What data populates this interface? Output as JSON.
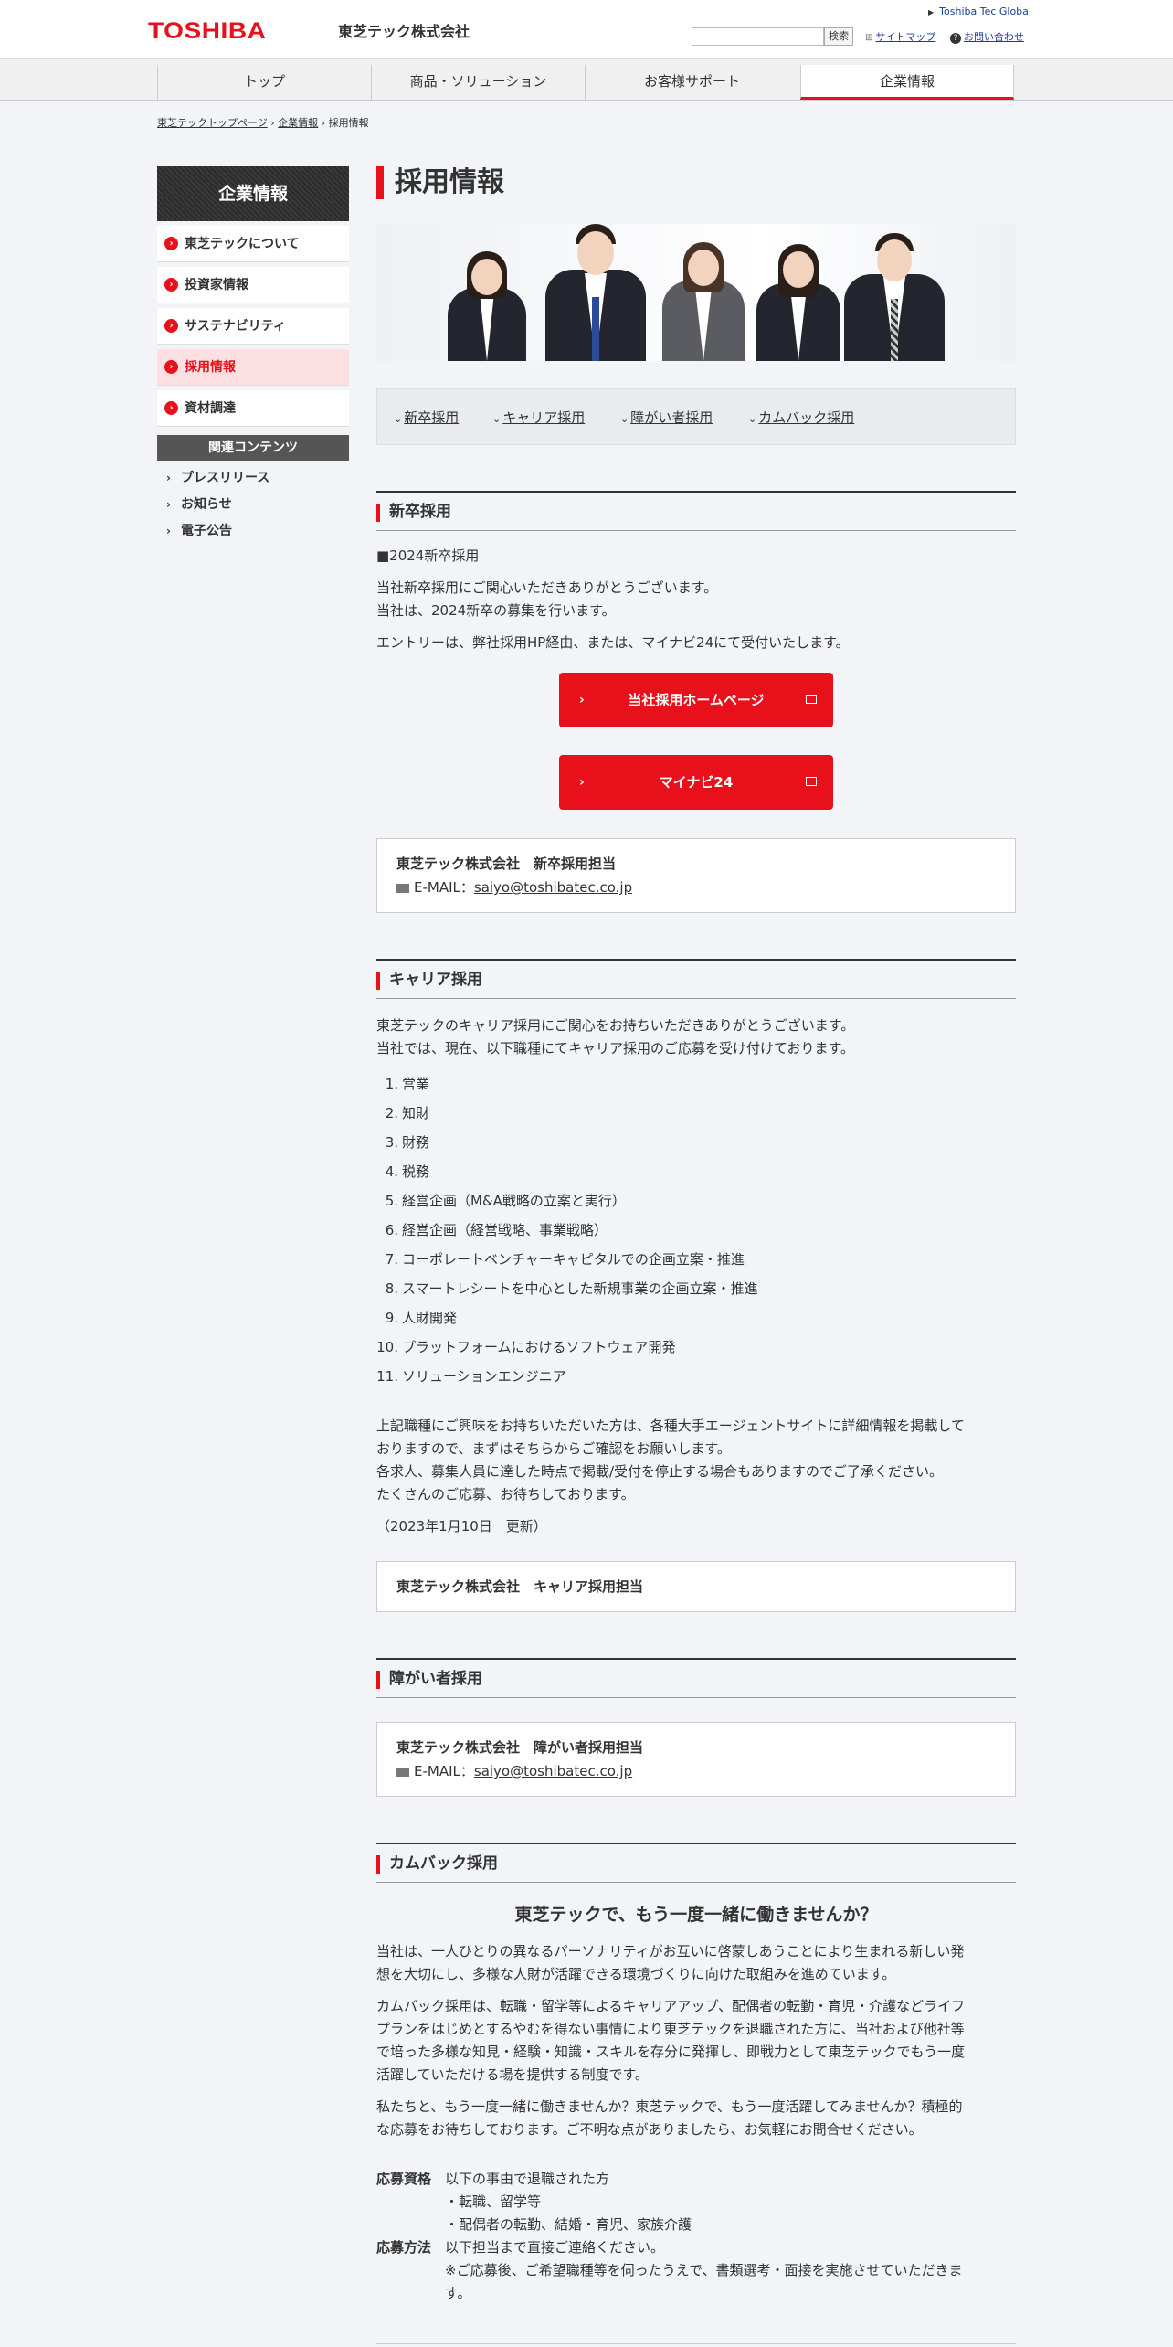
{
  "header": {
    "logo": "TOSHIBA",
    "company": "東芝テック株式会社",
    "global_link": "Toshiba Tec Global",
    "search_button": "検索",
    "sitemap": "サイトマップ",
    "contact": "お問い合わせ"
  },
  "nav": {
    "tabs": [
      {
        "label": "トップ"
      },
      {
        "label": "商品・ソリューション"
      },
      {
        "label": "お客様サポート"
      },
      {
        "label": "企業情報"
      }
    ]
  },
  "breadcrumb": {
    "items": [
      "東芝テックトップページ",
      "企業情報",
      "採用情報"
    ]
  },
  "sidebar": {
    "title": "企業情報",
    "items": [
      {
        "label": "東芝テックについて"
      },
      {
        "label": "投資家情報"
      },
      {
        "label": "サステナビリティ"
      },
      {
        "label": "採用情報"
      },
      {
        "label": "資材調達"
      }
    ],
    "related_title": "関連コンテンツ",
    "related": [
      {
        "label": "プレスリリース"
      },
      {
        "label": "お知らせ"
      },
      {
        "label": "電子公告"
      }
    ]
  },
  "main": {
    "title": "採用情報",
    "anchors": [
      "新卒採用",
      "キャリア採用",
      "障がい者採用",
      "カムバック採用"
    ],
    "new_grad": {
      "heading": "新卒採用",
      "sub": "■2024新卒採用",
      "p1_l1": "当社新卒採用にご関心いただきありがとうございます。",
      "p1_l2": "当社は、2024新卒の募集を行います。",
      "p2": "エントリーは、弊社採用HP経由、または、マイナビ24にて受付いたします。",
      "button1": "当社採用ホームページ",
      "button2": "マイナビ24",
      "contact_title": "東芝テック株式会社　新卒採用担当",
      "mail_label": "E-MAIL：",
      "mail": "saiyo@toshibatec.co.jp"
    },
    "career": {
      "heading": "キャリア採用",
      "p1_l1": "東芝テックのキャリア採用にご関心をお持ちいただきありがとうございます。",
      "p1_l2": "当社では、現在、以下職種にてキャリア採用のご応募を受け付けております。",
      "jobs": [
        "営業",
        "知財",
        "財務",
        "税務",
        "経営企画（M&A戦略の立案と実行）",
        "経営企画（経営戦略、事業戦略）",
        "コーポレートベンチャーキャピタルでの企画立案・推進",
        "スマートレシートを中心とした新規事業の企画立案・推進",
        "人財開発",
        "プラットフォームにおけるソフトウェア開発",
        "ソリューションエンジニア"
      ],
      "p2_l1": "上記職種にご興味をお持ちいただいた方は、各種大手エージェントサイトに詳細情報を掲載して",
      "p2_l2": "おりますので、まずはそちらからご確認をお願いします。",
      "p2_l3": "各求人、募集人員に達した時点で掲載/受付を停止する場合もありますのでご了承ください。",
      "p2_l4": "たくさんのご応募、お待ちしております。",
      "updated": "（2023年1月10日　更新）",
      "contact_title": "東芝テック株式会社　キャリア採用担当"
    },
    "disability": {
      "heading": "障がい者採用",
      "contact_title": "東芝テック株式会社　障がい者採用担当",
      "mail_label": "E-MAIL：",
      "mail": "saiyo@toshibatec.co.jp"
    },
    "comeback": {
      "heading": "カムバック採用",
      "sub": "東芝テックで、もう一度一緒に働きませんか？",
      "p1_l1": "当社は、一人ひとりの異なるパーソナリティがお互いに啓蒙しあうことにより生まれる新しい発",
      "p1_l2": "想を大切にし、多様な人財が活躍できる環境づくりに向けた取組みを進めています。",
      "p2_l1": "カムバック採用は、転職・留学等によるキャリアアップ、配偶者の転勤・育児・介護などライフ",
      "p2_l2": "プランをはじめとするやむを得ない事情により東芝テックを退職された方に、当社および他社等",
      "p2_l3": "で培った多様な知見・経験・知識・スキルを存分に発揮し、即戦力として東芝テックでもう一度",
      "p2_l4": "活躍していただける場を提供する制度です。",
      "p3_l1": "私たちと、もう一度一緒に働きませんか？東芝テックで、もう一度活躍してみませんか？積極的",
      "p3_l2": "な応募をお待ちしております。ご不明な点がありましたら、お気軽にお問合せください。",
      "qual_label": "応募資格",
      "qual_l1": "以下の事由で退職された方",
      "qual_l2": "・転職、留学等",
      "qual_l3": "・配偶者の転勤、結婚・育児、家族介護",
      "method_label": "応募方法",
      "method_l1": "以下担当まで直接ご連絡ください。",
      "method_l2": "※ご応募後、ご希望職種等を伺ったうえで、書類選考・面接を実施させていただきま",
      "method_l3": "す。"
    }
  }
}
